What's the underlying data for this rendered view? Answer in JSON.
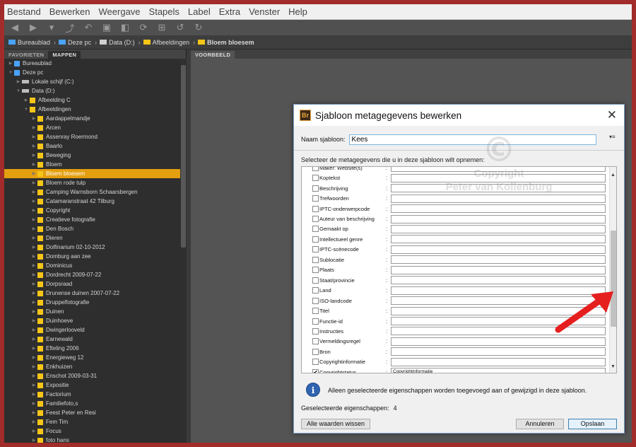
{
  "menubar": [
    "Bestand",
    "Bewerken",
    "Weergave",
    "Stapels",
    "Label",
    "Extra",
    "Venster",
    "Help"
  ],
  "breadcrumb": [
    "Bureaublad",
    "Deze pc",
    "Data (D:)",
    "Afbeeldingen",
    "Bloem bloesem"
  ],
  "left_tabs": [
    "FAVORIETEN",
    "MAPPEN"
  ],
  "right_tab": "VOORBEELD",
  "tree": [
    {
      "label": "Bureaublad",
      "level": 0,
      "icon": "desktop"
    },
    {
      "label": "Deze pc",
      "level": 0,
      "icon": "pc",
      "expanded": true
    },
    {
      "label": "Lokale schijf (C:)",
      "level": 1,
      "icon": "drive"
    },
    {
      "label": "Data (D:)",
      "level": 1,
      "icon": "drive",
      "expanded": true
    },
    {
      "label": "Afbeelding C",
      "level": 2,
      "icon": "folder"
    },
    {
      "label": "Afbeeldingen",
      "level": 2,
      "icon": "folder",
      "expanded": true
    },
    {
      "label": "Aardappelmandje",
      "level": 3,
      "icon": "folder"
    },
    {
      "label": "Arcen",
      "level": 3,
      "icon": "folder"
    },
    {
      "label": "Assenray Roermond",
      "level": 3,
      "icon": "folder"
    },
    {
      "label": "Baarlo",
      "level": 3,
      "icon": "folder"
    },
    {
      "label": "Beweging",
      "level": 3,
      "icon": "folder"
    },
    {
      "label": "Bloem",
      "level": 3,
      "icon": "folder"
    },
    {
      "label": "Bloem bloesem",
      "level": 3,
      "icon": "folder",
      "selected": true
    },
    {
      "label": "Bloem rode tulp",
      "level": 3,
      "icon": "folder"
    },
    {
      "label": "Camping Warnsborn Schaarsbergen",
      "level": 3,
      "icon": "folder"
    },
    {
      "label": "Catamaranstraat 42 Tilburg",
      "level": 3,
      "icon": "folder"
    },
    {
      "label": "Copyright",
      "level": 3,
      "icon": "folder"
    },
    {
      "label": "Creatieve fotografie",
      "level": 3,
      "icon": "folder"
    },
    {
      "label": "Den Bosch",
      "level": 3,
      "icon": "folder"
    },
    {
      "label": "Dieren",
      "level": 3,
      "icon": "folder"
    },
    {
      "label": "Dolfinarium 02-10-2012",
      "level": 3,
      "icon": "folder"
    },
    {
      "label": "Domburg aan zee",
      "level": 3,
      "icon": "folder"
    },
    {
      "label": "Dominicus",
      "level": 3,
      "icon": "folder"
    },
    {
      "label": "Dordrecht 2009-07-22",
      "level": 3,
      "icon": "folder"
    },
    {
      "label": "Dorpsraad",
      "level": 3,
      "icon": "folder"
    },
    {
      "label": "Drunense duinen 2007-07-22",
      "level": 3,
      "icon": "folder"
    },
    {
      "label": "Druppelfotografie",
      "level": 3,
      "icon": "folder"
    },
    {
      "label": "Duinen",
      "level": 3,
      "icon": "folder"
    },
    {
      "label": "Duinhoeve",
      "level": 3,
      "icon": "folder"
    },
    {
      "label": "Dwingerlooveld",
      "level": 3,
      "icon": "folder"
    },
    {
      "label": "Earnewald",
      "level": 3,
      "icon": "folder"
    },
    {
      "label": "Efteling 2006",
      "level": 3,
      "icon": "folder"
    },
    {
      "label": "Energieweg 12",
      "level": 3,
      "icon": "folder"
    },
    {
      "label": "Enkhuizen",
      "level": 3,
      "icon": "folder"
    },
    {
      "label": "Enschot 2009-03-31",
      "level": 3,
      "icon": "folder"
    },
    {
      "label": "Expositie",
      "level": 3,
      "icon": "folder"
    },
    {
      "label": "Factorium",
      "level": 3,
      "icon": "folder"
    },
    {
      "label": "Familiefoto,s",
      "level": 3,
      "icon": "folder"
    },
    {
      "label": "Feest Peter en Resi",
      "level": 3,
      "icon": "folder"
    },
    {
      "label": "Fem Tim",
      "level": 3,
      "icon": "folder"
    },
    {
      "label": "Focus",
      "level": 3,
      "icon": "folder"
    },
    {
      "label": "foto hans",
      "level": 3,
      "icon": "folder"
    }
  ],
  "dialog": {
    "title": "Sjabloon metagegevens bewerken",
    "logo": "Br",
    "name_label": "Naam sjabloon:",
    "name_value": "Kees",
    "instruction": "Selecteer de metagegevens die u in deze sjabloon wilt opnemen:",
    "fields": [
      {
        "label": "Maker: Website(s)",
        "checked": false,
        "value": ""
      },
      {
        "label": "Koptekst",
        "checked": false,
        "value": ""
      },
      {
        "label": "Beschrijving",
        "checked": false,
        "value": ""
      },
      {
        "label": "Trefwoorden",
        "checked": false,
        "value": ""
      },
      {
        "label": "IPTC-onderwerpcode",
        "checked": false,
        "value": ""
      },
      {
        "label": "Auteur van beschrijving",
        "checked": false,
        "value": ""
      },
      {
        "label": "Gemaakt op",
        "checked": false,
        "value": ""
      },
      {
        "label": "Intellectueel genre",
        "checked": false,
        "value": ""
      },
      {
        "label": "IPTC-scènecode",
        "checked": false,
        "value": ""
      },
      {
        "label": "Sublocatie",
        "checked": false,
        "value": ""
      },
      {
        "label": "Plaats",
        "checked": false,
        "value": ""
      },
      {
        "label": "Staat/provincie",
        "checked": false,
        "value": ""
      },
      {
        "label": "Land",
        "checked": false,
        "value": ""
      },
      {
        "label": "ISO-landcode",
        "checked": false,
        "value": ""
      },
      {
        "label": "Titel",
        "checked": false,
        "value": ""
      },
      {
        "label": "Functie-id",
        "checked": false,
        "value": ""
      },
      {
        "label": "Instructies",
        "checked": false,
        "value": ""
      },
      {
        "label": "Vermeldingsregel",
        "checked": false,
        "value": ""
      },
      {
        "label": "Bron",
        "checked": false,
        "value": ""
      },
      {
        "label": "Copyrightinformatie",
        "checked": false,
        "value": ""
      },
      {
        "label": "Copyrightstatus",
        "checked": true,
        "value": "Copyrightinformatie"
      }
    ],
    "info_text": "Alleen geselecteerde eigenschappen worden toegevoegd aan of gewijzigd in deze sjabloon.",
    "selected_label": "Geselecteerde eigenschappen:",
    "selected_count": "4",
    "btn_clear": "Alle waarden wissen",
    "btn_cancel": "Annuleren",
    "btn_save": "Opslaan"
  },
  "watermark": {
    "symbol": "©",
    "line1": "Copyright",
    "line2": "Peter van Kollenburg"
  },
  "colors": {
    "selection": "#e39f0e",
    "frame": "#a12c2a",
    "arrow": "#e51e1e",
    "folder": "#f5c518"
  }
}
